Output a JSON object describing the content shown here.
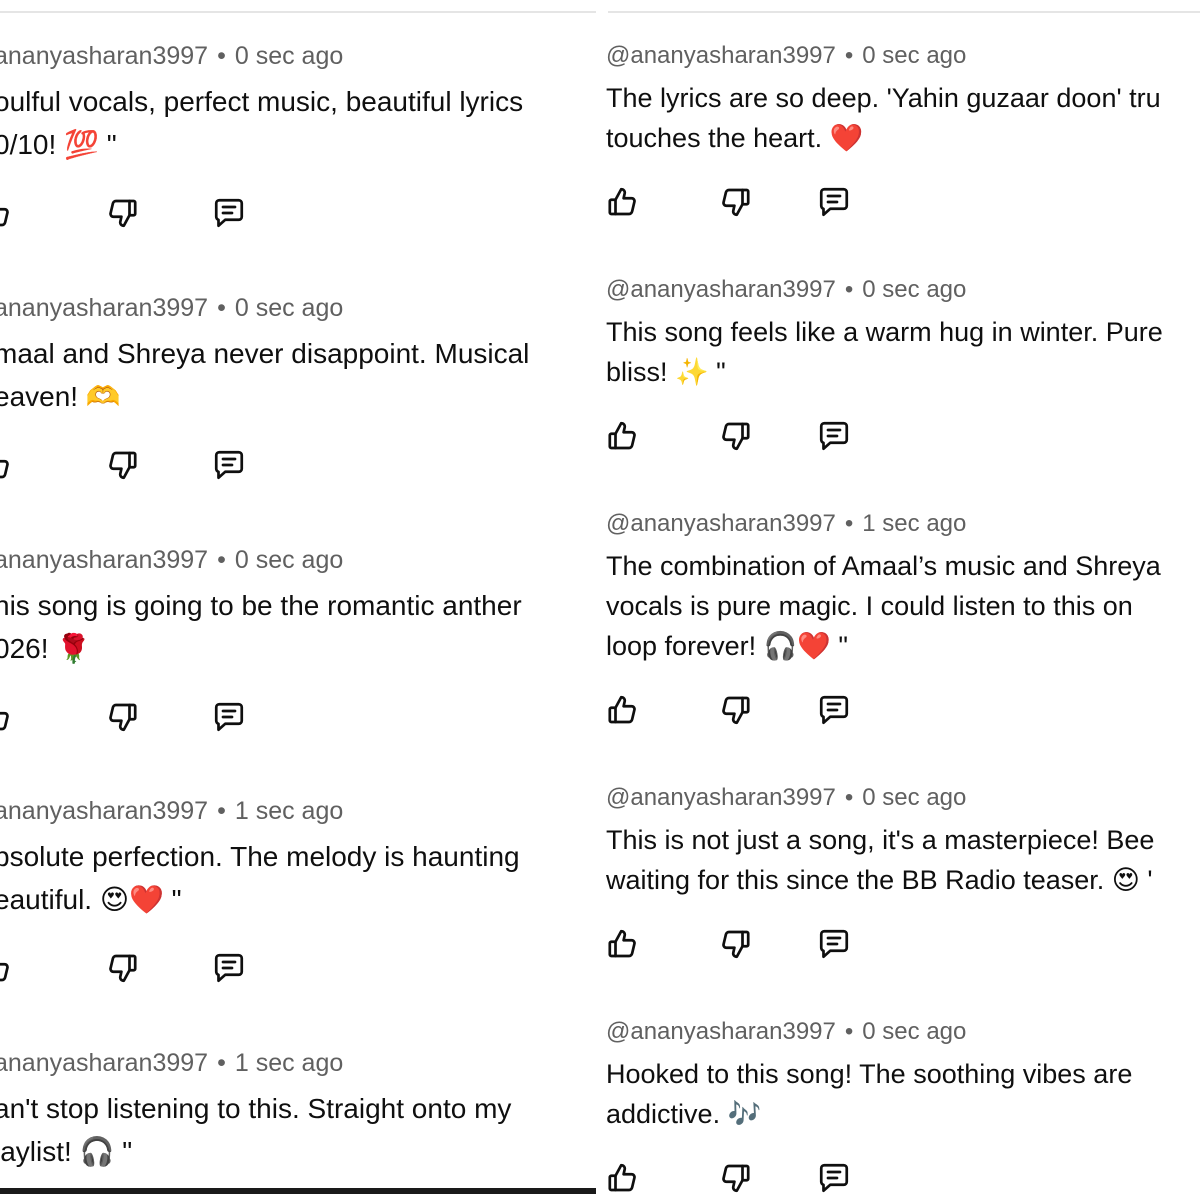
{
  "left_panel": {
    "comments": [
      {
        "username": "ananyasharan3997",
        "time": "0 sec ago",
        "lines": [
          "oulful vocals, perfect music, beautiful lyrics",
          "0/10! 💯 \""
        ]
      },
      {
        "username": "ananyasharan3997",
        "time": "0 sec ago",
        "lines": [
          "maal and Shreya never disappoint. Musical",
          "eaven! 🫶"
        ]
      },
      {
        "username": "ananyasharan3997",
        "time": "0 sec ago",
        "lines": [
          "his song is going to be the romantic anther",
          "026! 🌹"
        ]
      },
      {
        "username": "ananyasharan3997",
        "time": "1 sec ago",
        "lines": [
          "bsolute perfection. The melody is haunting",
          "eautiful. 😍❤️ \""
        ]
      },
      {
        "username": "ananyasharan3997",
        "time": "1 sec ago",
        "lines": [
          "an't stop listening to this. Straight onto my",
          "laylist! 🎧 \""
        ]
      }
    ]
  },
  "right_panel": {
    "comments": [
      {
        "username": "@ananyasharan3997",
        "time": "0 sec ago",
        "lines": [
          "The lyrics are so deep. 'Yahin guzaar doon' tru",
          "touches the heart. ❤️"
        ]
      },
      {
        "username": "@ananyasharan3997",
        "time": "0 sec ago",
        "lines": [
          "This song feels like a warm hug in winter. Pure",
          "bliss! ✨ \""
        ]
      },
      {
        "username": "@ananyasharan3997",
        "time": "1 sec ago",
        "lines": [
          "The combination of Amaal’s music and Shreya",
          "vocals is pure magic. I could listen to this on",
          "loop forever! 🎧❤️ \""
        ]
      },
      {
        "username": "@ananyasharan3997",
        "time": "0 sec ago",
        "lines": [
          "This is not just a song, it's a masterpiece! Bee",
          "waiting for this since the BB Radio teaser. 😍 '"
        ]
      },
      {
        "username": "@ananyasharan3997",
        "time": "0 sec ago",
        "lines": [
          "Hooked to this song! The soothing vibes are",
          "addictive. 🎶"
        ]
      }
    ]
  },
  "colors": {
    "text": "#0f0f0f",
    "meta": "#606060",
    "divider": "#e5e5e5"
  }
}
